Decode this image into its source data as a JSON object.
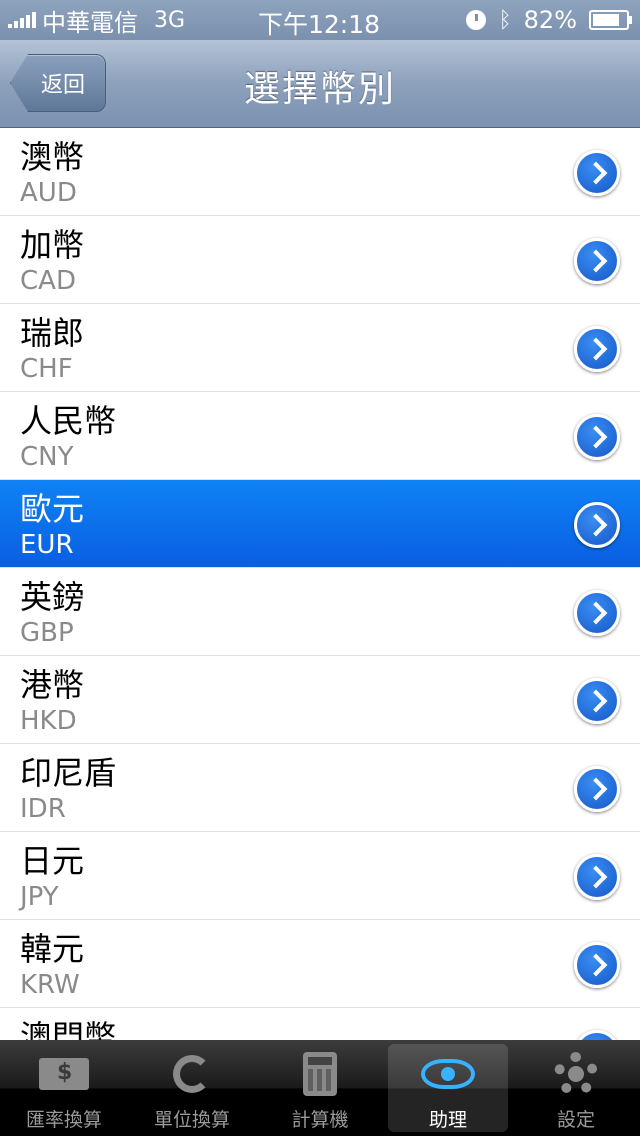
{
  "status_bar": {
    "carrier": "中華電信",
    "network": "3G",
    "time": "下午12:18",
    "battery": "82%",
    "battery_level": 0.82
  },
  "nav": {
    "back_label": "返回",
    "title": "選擇幣別"
  },
  "currencies": [
    {
      "name": "澳幣",
      "code": "AUD"
    },
    {
      "name": "加幣",
      "code": "CAD"
    },
    {
      "name": "瑞郎",
      "code": "CHF"
    },
    {
      "name": "人民幣",
      "code": "CNY"
    },
    {
      "name": "歐元",
      "code": "EUR"
    },
    {
      "name": "英鎊",
      "code": "GBP"
    },
    {
      "name": "港幣",
      "code": "HKD"
    },
    {
      "name": "印尼盾",
      "code": "IDR"
    },
    {
      "name": "日元",
      "code": "JPY"
    },
    {
      "name": "韓元",
      "code": "KRW"
    },
    {
      "name": "澳門幣",
      "code": ""
    }
  ],
  "selected_code": "EUR",
  "tab_bar": {
    "tabs": [
      {
        "label": "匯率換算",
        "icon": "money-exchange-icon"
      },
      {
        "label": "單位換算",
        "icon": "refresh-icon"
      },
      {
        "label": "計算機",
        "icon": "calculator-icon"
      },
      {
        "label": "助理",
        "icon": "eye-icon"
      },
      {
        "label": "設定",
        "icon": "gear-icon"
      }
    ],
    "active_index": 3,
    "active_color": "#38b2ff"
  }
}
